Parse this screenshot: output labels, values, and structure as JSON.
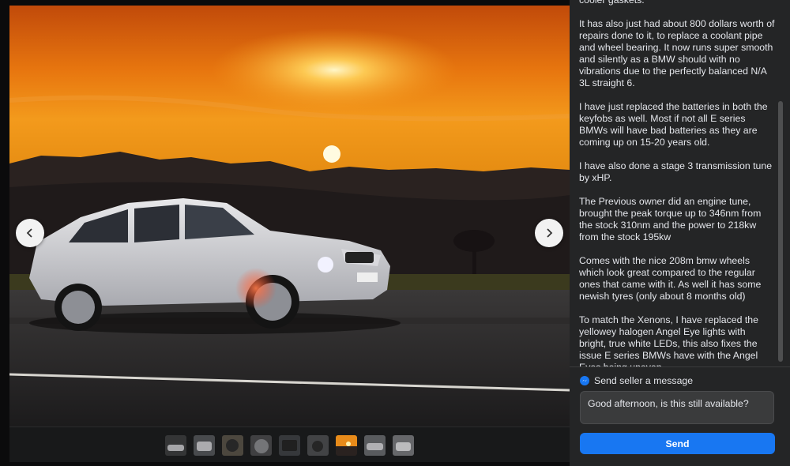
{
  "gallery": {
    "image_description": "car-photo-sunset",
    "prev_icon": "chevron-left-icon",
    "next_icon": "chevron-right-icon",
    "thumbnails": [
      {
        "index": 1,
        "active": false
      },
      {
        "index": 2,
        "active": false
      },
      {
        "index": 3,
        "active": false
      },
      {
        "index": 4,
        "active": false
      },
      {
        "index": 5,
        "active": false
      },
      {
        "index": 6,
        "active": false
      },
      {
        "index": 7,
        "active": true
      },
      {
        "index": 8,
        "active": false
      },
      {
        "index": 9,
        "active": false
      }
    ]
  },
  "listing": {
    "description": [
      "cooler gaskets.",
      "It has also just had about 800 dollars worth of repairs done to it, to replace a coolant pipe and wheel bearing. It now runs super smooth and silently as a BMW should with no vibrations due to the perfectly balanced N/A 3L straight 6.",
      "I have just replaced the batteries in both the keyfobs as well. Most if not all E series BMWs will have bad batteries as they are coming up on 15-20 years old.",
      "I have also done a stage 3 transmission tune by xHP.",
      "The Previous owner did an engine tune, brought the peak torque up to 346nm from the stock 310nm and the power to 218kw from the stock 195kw",
      "Comes with the nice 208m bmw wheels which look great compared to the regular ones that came with it. As well it has some newish tyres (only about 8 months old)",
      "To match the Xenons, I have replaced the yellowey halogen Angel Eye lights with bright, true white LEDs, this also fixes the issue E series BMWs have with the Angel Eyes being uneven"
    ]
  },
  "message": {
    "heading": "Send seller a message",
    "icon": "messenger-icon",
    "input_value": "Good afternoon, is this still available?",
    "send_label": "Send"
  },
  "colors": {
    "accent": "#1877f2",
    "panel_bg": "#242526",
    "text": "#e4e6eb"
  }
}
